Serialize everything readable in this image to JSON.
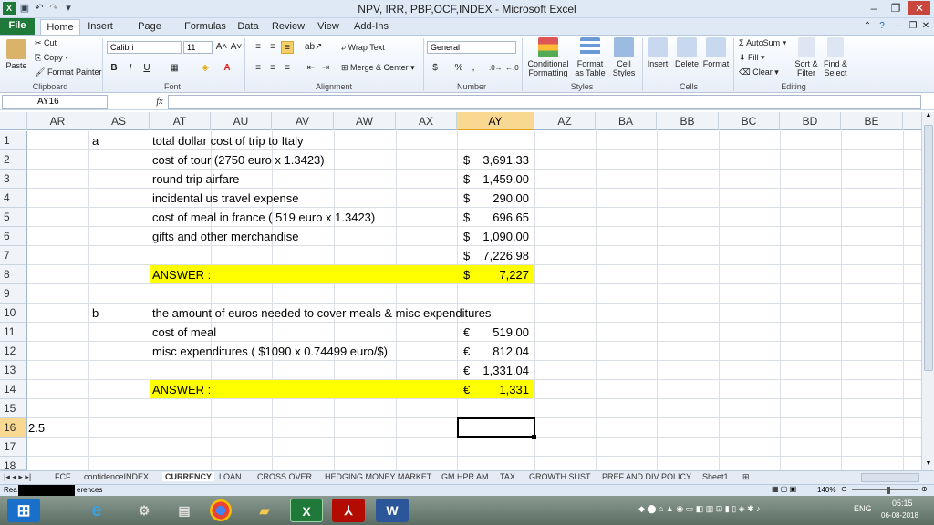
{
  "window": {
    "title": "NPV, IRR, PBP,OCF,INDEX  -  Microsoft Excel",
    "controls": [
      "–",
      "❐",
      "✕"
    ]
  },
  "ribbon_tabs": [
    "File",
    "Home",
    "Insert",
    "Page Layout",
    "Formulas",
    "Data",
    "Review",
    "View",
    "Add-Ins"
  ],
  "clipboard": {
    "paste": "Paste",
    "cut": "Cut",
    "copy": "Copy",
    "format_painter": "Format Painter",
    "label": "Clipboard"
  },
  "font": {
    "name": "Calibri",
    "size": "11",
    "bold": "B",
    "italic": "I",
    "underline": "U",
    "label": "Font"
  },
  "alignment": {
    "wrap_text": "Wrap Text",
    "merge_center": "Merge & Center",
    "label": "Alignment"
  },
  "number": {
    "format": "General",
    "currency": "$",
    "percent": "%",
    "comma": ",",
    "label": "Number"
  },
  "styles": {
    "conditional": "Conditional Formatting",
    "format_table": "Format as Table",
    "cell_styles": "Cell Styles",
    "label": "Styles"
  },
  "cells": {
    "insert": "Insert",
    "delete": "Delete",
    "format": "Format",
    "label": "Cells"
  },
  "editing": {
    "autosum": "AutoSum",
    "fill": "Fill",
    "clear": "Clear",
    "sort_filter": "Sort & Filter",
    "find_select": "Find & Select",
    "label": "Editing"
  },
  "formula_bar": {
    "name_box": "AY16",
    "fx": "fx",
    "formula": ""
  },
  "columns": [
    "AR",
    "AS",
    "AT",
    "AU",
    "AV",
    "AW",
    "AX",
    "AY",
    "AZ",
    "BA",
    "BB",
    "BC",
    "BD",
    "BE"
  ],
  "selected_column": "AY",
  "rows": [
    "1",
    "2",
    "3",
    "4",
    "5",
    "6",
    "7",
    "8",
    "9",
    "10",
    "11",
    "12",
    "13",
    "14",
    "15",
    "16",
    "17",
    "18"
  ],
  "selected_row": "16",
  "cells_text": {
    "a_label": "a",
    "r1": "total dollar cost of trip to Italy",
    "r2": "cost of tour (2750 euro x 1.3423)",
    "r3": "round trip airfare",
    "r4": "incidental us travel expense",
    "r5": "cost of meal in france ( 519 euro x 1.3423)",
    "r6": "gifts and other merchandise",
    "r8": "ANSWER :",
    "b_label": "b",
    "r10": "the amount of euros needed to cover meals & misc expenditures",
    "r11": "cost of meal",
    "r12": "misc expenditures ( $1090 x  0.74499 euro/$)",
    "r14": "ANSWER :",
    "r16_ar": "2.5"
  },
  "amounts": {
    "r2": {
      "sym": "$",
      "val": "3,691.33"
    },
    "r3": {
      "sym": "$",
      "val": "1,459.00"
    },
    "r4": {
      "sym": "$",
      "val": "290.00"
    },
    "r5": {
      "sym": "$",
      "val": "696.65"
    },
    "r6": {
      "sym": "$",
      "val": "1,090.00"
    },
    "r7": {
      "sym": "$",
      "val": "7,226.98"
    },
    "r8": {
      "sym": "$",
      "val": "7,227"
    },
    "r11": {
      "sym": "€",
      "val": "519.00"
    },
    "r12": {
      "sym": "€",
      "val": "812.04"
    },
    "r13": {
      "sym": "€",
      "val": "1,331.04"
    },
    "r14": {
      "sym": "€",
      "val": "1,331"
    }
  },
  "sheet_tabs": [
    "FCF",
    "confidenceINDEX",
    "CURRENCY",
    "LOAN",
    "CROSS OVER",
    "HEDGING MONEY MARKET",
    "GM HPR AM",
    "TAX",
    "GROWTH SUST",
    "PREF AND DIV POLICY",
    "Sheet1"
  ],
  "active_sheet": "CURRENCY",
  "status": {
    "ready": "Rea",
    "references": "erences",
    "zoom": "140%"
  },
  "taskbar": {
    "lang": "ENG",
    "time": "05:15",
    "date": "06-08-2018"
  },
  "colors": {
    "highlight": "#ffff00",
    "selected_header": "#f9d891",
    "excel_green": "#1f7a3a"
  }
}
